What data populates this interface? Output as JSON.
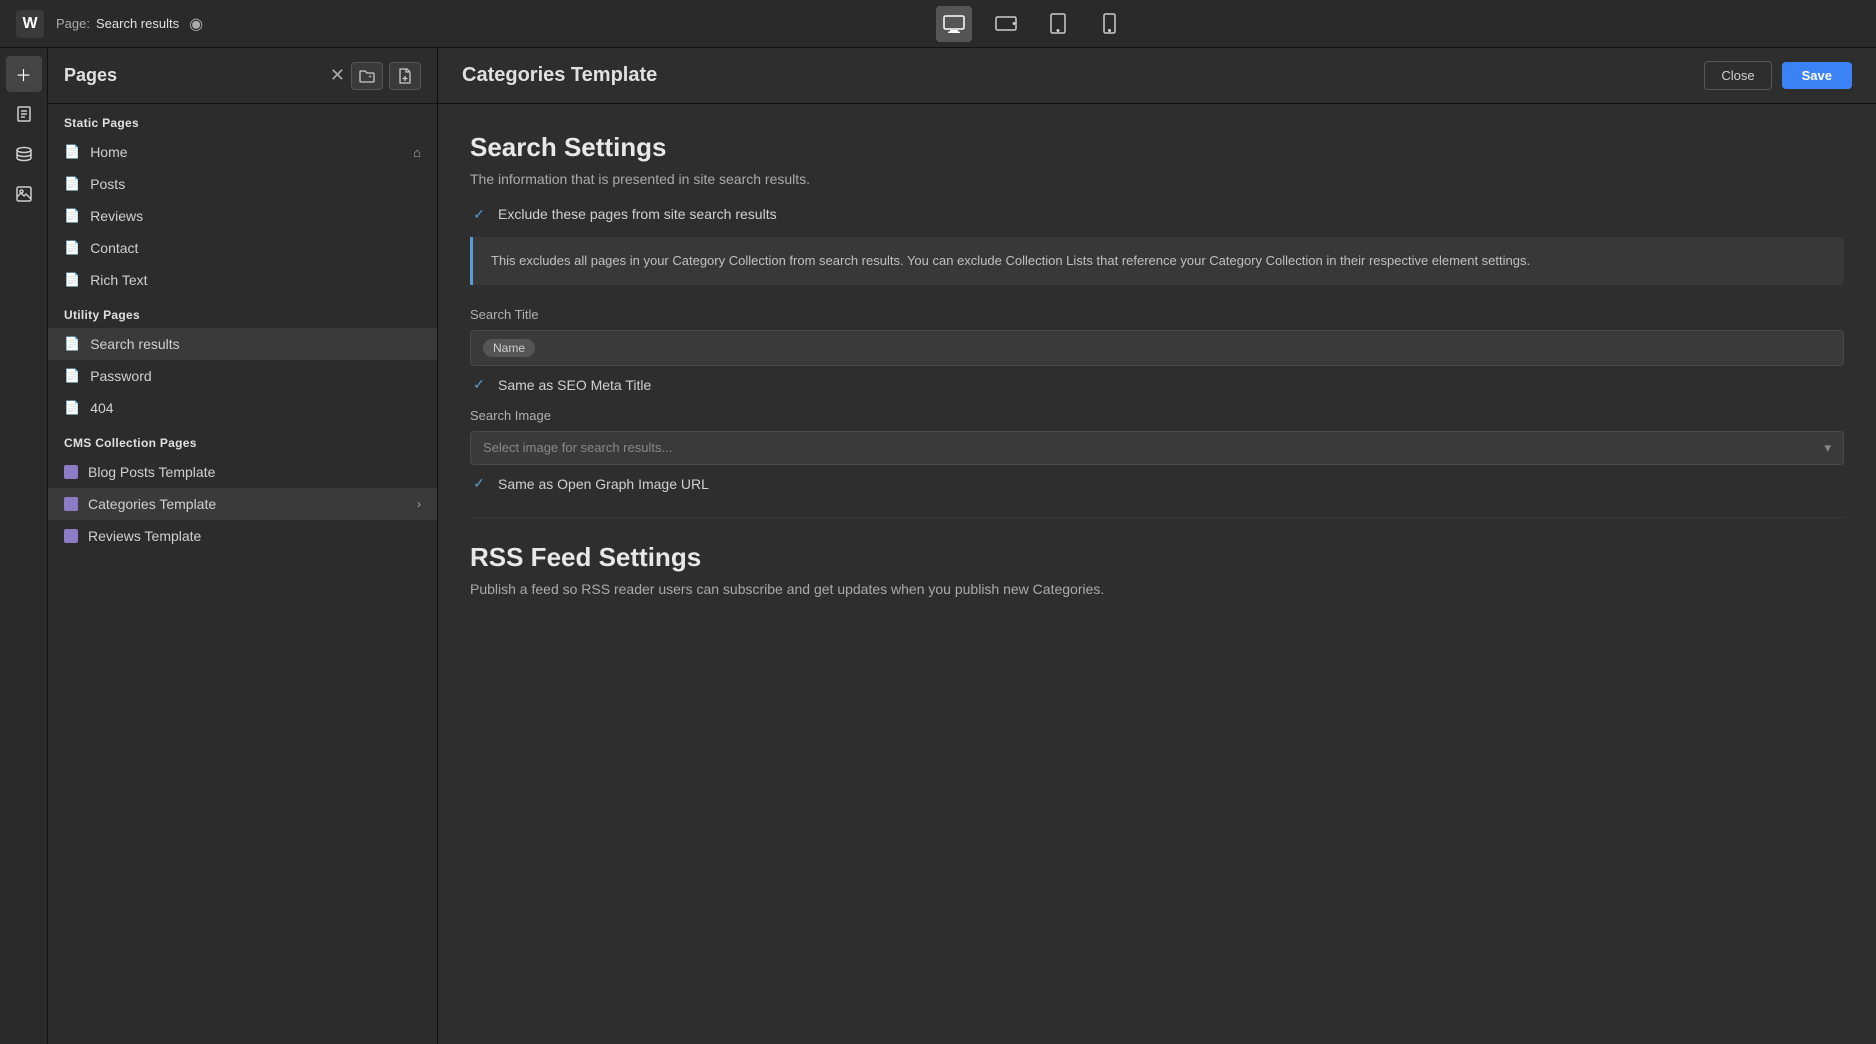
{
  "topbar": {
    "logo": "W",
    "page_label": "Page:",
    "page_name": "Search results",
    "devices": [
      {
        "label": "Desktop",
        "icon": "🖥",
        "active": true
      },
      {
        "label": "Tablet landscape",
        "icon": "⬜",
        "active": false
      },
      {
        "label": "Tablet portrait",
        "icon": "📱",
        "active": false
      },
      {
        "label": "Mobile",
        "icon": "📲",
        "active": false
      }
    ]
  },
  "pages_panel": {
    "title": "Pages",
    "close_icon": "✕",
    "add_folder_icon": "📁+",
    "add_page_icon": "📄+",
    "sections": [
      {
        "name": "Static Pages",
        "items": [
          {
            "name": "Home",
            "has_home": true
          },
          {
            "name": "Posts",
            "has_home": false
          },
          {
            "name": "Reviews",
            "has_home": false
          },
          {
            "name": "Contact",
            "has_home": false
          },
          {
            "name": "Rich Text",
            "has_home": false
          }
        ]
      },
      {
        "name": "Utility Pages",
        "items": [
          {
            "name": "Search results",
            "active": true
          },
          {
            "name": "Password"
          },
          {
            "name": "404"
          }
        ]
      },
      {
        "name": "CMS Collection Pages",
        "items": [
          {
            "name": "Blog Posts Template",
            "cms": true
          },
          {
            "name": "Categories Template",
            "cms": true,
            "active": true,
            "arrow": true
          },
          {
            "name": "Reviews Template",
            "cms": true
          }
        ]
      }
    ]
  },
  "content": {
    "title": "Categories Template",
    "close_label": "Close",
    "save_label": "Save",
    "search_settings": {
      "title": "Search Settings",
      "description": "The information that is presented in site search results.",
      "exclude_checkbox": {
        "checked": true,
        "label": "Exclude these pages from site search results"
      },
      "info_text": "This excludes all pages in your Category Collection from search results. You can exclude Collection Lists that reference your Category Collection in their respective element settings.",
      "search_title_label": "Search Title",
      "search_title_tag": "Name",
      "same_as_seo_checked": true,
      "same_as_seo_label": "Same as SEO Meta Title",
      "search_image_label": "Search Image",
      "search_image_placeholder": "Select image for search results...",
      "same_as_og_checked": true,
      "same_as_og_label": "Same as Open Graph Image URL"
    },
    "rss_settings": {
      "title": "RSS Feed Settings",
      "description": "Publish a feed so RSS reader users can subscribe and get updates when you publish new Categories."
    }
  }
}
